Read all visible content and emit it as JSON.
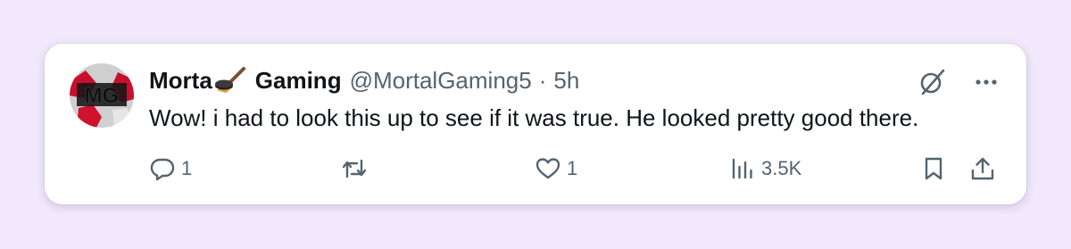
{
  "tweet": {
    "author_name_part1": "Morta",
    "author_name_part2": "Gaming",
    "author_emoji": "hockey-stick-puck-emoji",
    "handle": "@MortalGaming5",
    "separator": "·",
    "time": "5h",
    "avatar_initials": "MG",
    "text": "Wow! i had to look this up to see if it was true. He looked pretty good there.",
    "reply_count": "1",
    "retweet_count": "",
    "like_count": "1",
    "view_count": "3.5K"
  },
  "icons": {
    "grok": "grok-slash-icon",
    "more": "more-dots-icon",
    "reply": "reply-bubble-icon",
    "retweet": "retweet-icon",
    "like": "heart-icon",
    "views": "views-bar-chart-icon",
    "bookmark": "bookmark-icon",
    "share": "share-upload-icon"
  },
  "colors": {
    "page_background": "#f1e8fb",
    "card_background": "#ffffff",
    "text_primary": "#0f1419",
    "text_secondary": "#536471"
  }
}
